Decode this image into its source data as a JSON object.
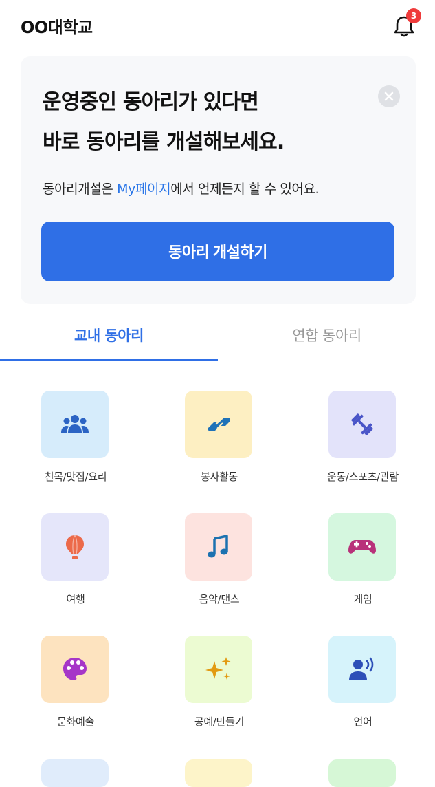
{
  "header": {
    "school_name": "OO대학교",
    "notification_count": "3"
  },
  "promo": {
    "title_line1": "운영중인 동아리가 있다면",
    "title_line2": "바로 동아리를 개설해보세요.",
    "desc_prefix": "동아리개설은 ",
    "desc_link": "My페이지",
    "desc_suffix": "에서 언제든지 할 수 있어요.",
    "cta_label": "동아리 개설하기"
  },
  "tabs": [
    {
      "label": "교내 동아리",
      "active": true
    },
    {
      "label": "연합 동아리",
      "active": false
    }
  ],
  "categories": [
    {
      "label": "친목/맛집/요리",
      "icon": "group-icon",
      "bg": "#d6ecfb",
      "color": "#2c64c4"
    },
    {
      "label": "봉사활동",
      "icon": "handshake-icon",
      "bg": "#fdefc2",
      "color": "#1f72b8"
    },
    {
      "label": "운동/스포츠/관람",
      "icon": "dumbbell-icon",
      "bg": "#e3e3fa",
      "color": "#4a55c8"
    },
    {
      "label": "여행",
      "icon": "hot-air-balloon-icon",
      "bg": "#e5e6fa",
      "color": "#ec6a4a"
    },
    {
      "label": "음악/댄스",
      "icon": "music-note-icon",
      "bg": "#fde3df",
      "color": "#1c72b0"
    },
    {
      "label": "게임",
      "icon": "gamepad-icon",
      "bg": "#d5f7df",
      "color": "#b8327a"
    },
    {
      "label": "문화예술",
      "icon": "palette-icon",
      "bg": "#fde3bf",
      "color": "#a636c8"
    },
    {
      "label": "공예/만들기",
      "icon": "sparkles-icon",
      "bg": "#ecfbd2",
      "color": "#e29a12"
    },
    {
      "label": "언어",
      "icon": "speaking-person-icon",
      "bg": "#d6f3fb",
      "color": "#2c4fb8"
    }
  ],
  "partial_row_bgs": [
    "#e0ecfb",
    "#fdf4c9",
    "#d6f7d6"
  ]
}
